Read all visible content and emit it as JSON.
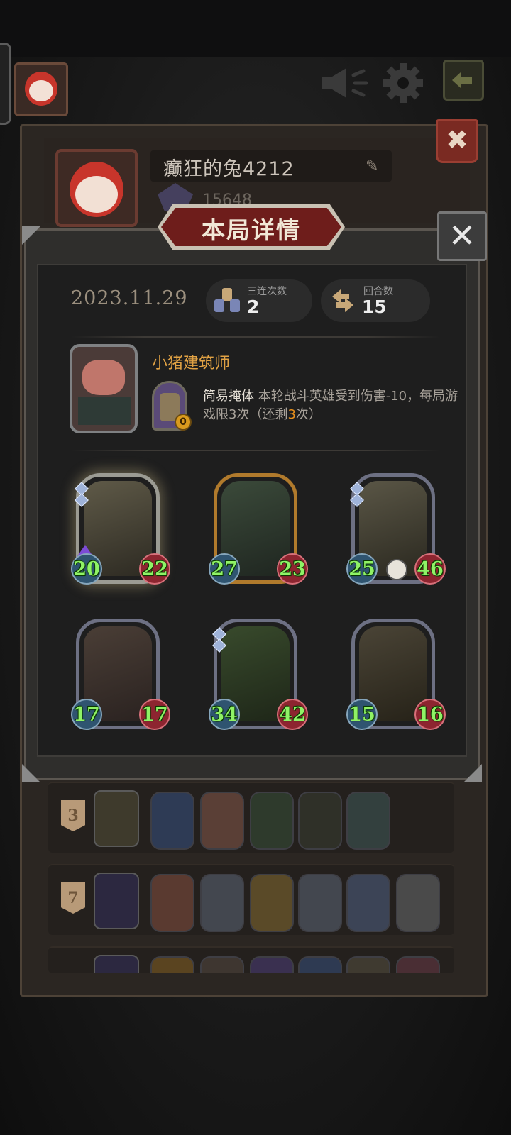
{
  "background": {
    "player_name": "癫狂的兔4212",
    "score": "15648",
    "list_rows": [
      {
        "rank": "3"
      },
      {
        "rank": "7"
      },
      {
        "rank": ""
      }
    ]
  },
  "modal": {
    "title": "本局详情",
    "date": "2023.11.29",
    "stats": {
      "triples_label": "三连次数",
      "triples_value": "2",
      "turns_label": "回合数",
      "turns_value": "15"
    },
    "hero": {
      "name": "小猪建筑师",
      "skill_name": "简易掩体",
      "skill_text_part1": " 本轮战斗英雄受到伤害-10，每局游戏限3次（还剩",
      "skill_remaining": "3",
      "skill_text_part2": "次）",
      "skill_uses_badge": "0"
    },
    "minions": [
      {
        "attack": "20",
        "health": "22",
        "frame": "glow"
      },
      {
        "attack": "27",
        "health": "23",
        "frame": "gold"
      },
      {
        "attack": "25",
        "health": "46",
        "frame": "normal"
      },
      {
        "attack": "17",
        "health": "17",
        "frame": "normal"
      },
      {
        "attack": "34",
        "health": "42",
        "frame": "normal"
      },
      {
        "attack": "15",
        "health": "16",
        "frame": "normal"
      }
    ]
  },
  "icons": {
    "speaker": "speaker-icon",
    "settings": "gear-icon",
    "exit": "exit-icon",
    "close": "close-icon"
  },
  "colors": {
    "title_banner": "#6e1d1b",
    "hero_name": "#e1a244",
    "stat_number": "#8ff266",
    "highlight": "#e8901c"
  }
}
